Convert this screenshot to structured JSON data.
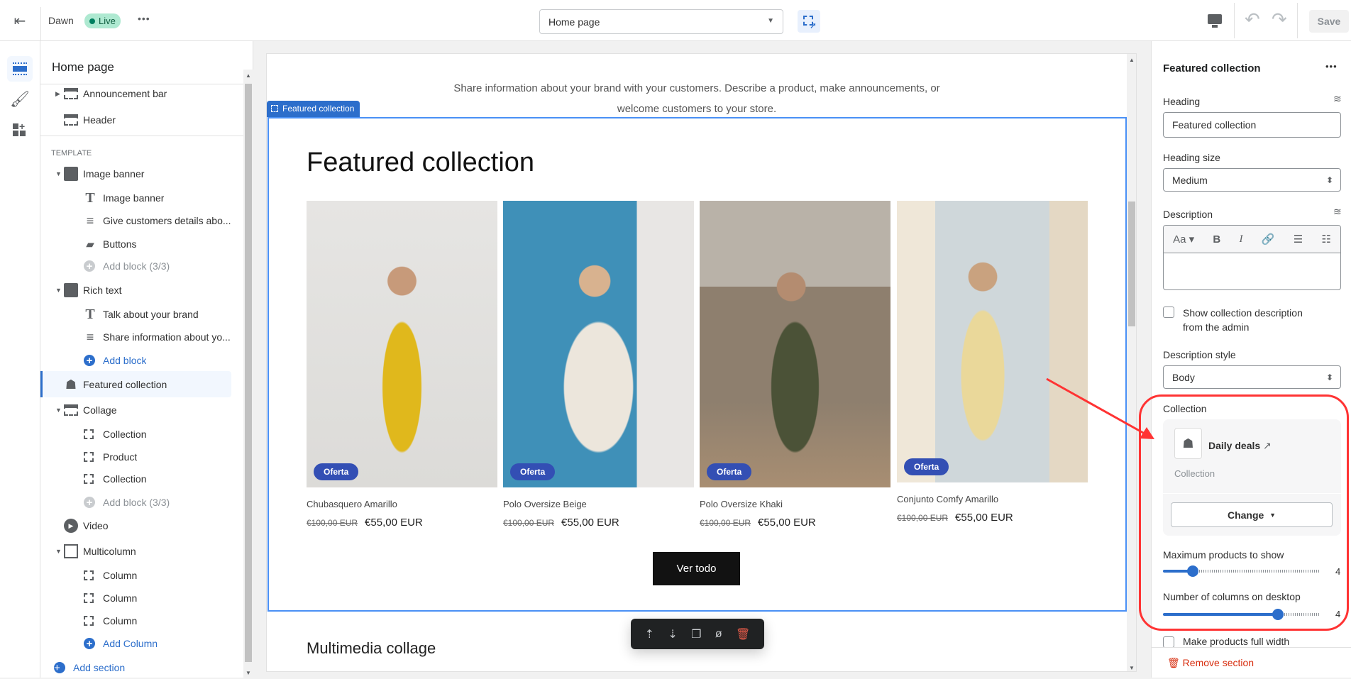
{
  "topbar": {
    "theme": "Dawn",
    "status": "Live",
    "more": "•••",
    "page_select": "Home page",
    "save": "Save"
  },
  "left": {
    "title": "Home page",
    "template_label": "TEMPLATE",
    "items": [
      {
        "label": "Announcement bar",
        "level": 0
      },
      {
        "label": "Header",
        "level": 0
      },
      {
        "label": "Image banner",
        "level": 0
      },
      {
        "label": "Image banner",
        "level": 1
      },
      {
        "label": "Give customers details abo...",
        "level": 1
      },
      {
        "label": "Buttons",
        "level": 1
      },
      {
        "label": "Add block (3/3)",
        "level": 1
      },
      {
        "label": "Rich text",
        "level": 0
      },
      {
        "label": "Talk about your brand",
        "level": 1
      },
      {
        "label": "Share information about yo...",
        "level": 1
      },
      {
        "label": "Add block",
        "level": 1
      },
      {
        "label": "Featured collection",
        "level": 0
      },
      {
        "label": "Collage",
        "level": 0
      },
      {
        "label": "Collection",
        "level": 1
      },
      {
        "label": "Product",
        "level": 1
      },
      {
        "label": "Collection",
        "level": 1
      },
      {
        "label": "Add block (3/3)",
        "level": 1
      },
      {
        "label": "Video",
        "level": 0
      },
      {
        "label": "Multicolumn",
        "level": 0
      },
      {
        "label": "Column",
        "level": 1
      },
      {
        "label": "Column",
        "level": 1
      },
      {
        "label": "Column",
        "level": 1
      },
      {
        "label": "Add Column",
        "level": 1
      },
      {
        "label": "Add section",
        "level": 0
      }
    ]
  },
  "preview": {
    "richtext_line1": "Share information about your brand with your customers. Describe a product, make announcements, or",
    "richtext_line2": "welcome customers to your store.",
    "section_tag": "Featured collection",
    "heading": "Featured collection",
    "products": [
      {
        "title": "Chubasquero Amarillo",
        "old": "€100,00 EUR",
        "price": "€55,00 EUR",
        "badge": "Oferta"
      },
      {
        "title": "Polo Oversize Beige",
        "old": "€100,00 EUR",
        "price": "€55,00 EUR",
        "badge": "Oferta"
      },
      {
        "title": "Polo Oversize Khaki",
        "old": "€100,00 EUR",
        "price": "€55,00 EUR",
        "badge": "Oferta"
      },
      {
        "title": "Conjunto Comfy Amarillo",
        "old": "€100,00 EUR",
        "price": "€55,00 EUR",
        "badge": "Oferta"
      }
    ],
    "view_all": "Ver todo",
    "next_section": "Multimedia collage"
  },
  "right": {
    "title": "Featured collection",
    "more": "•••",
    "heading_label": "Heading",
    "heading_value": "Featured collection",
    "heading_size_label": "Heading size",
    "heading_size_value": "Medium",
    "description_label": "Description",
    "show_desc_label": "Show collection description from the admin",
    "desc_style_label": "Description style",
    "desc_style_value": "Body",
    "collection_label": "Collection",
    "collection_name": "Daily deals",
    "collection_type": "Collection",
    "change": "Change",
    "max_products_label": "Maximum products to show",
    "max_products_value": "4",
    "max_products_fraction": 0.19,
    "columns_label": "Number of columns on desktop",
    "columns_value": "4",
    "columns_fraction": 0.73,
    "full_width_label": "Make products full width",
    "remove": "Remove section"
  },
  "colors": {
    "accent": "#2c6ecb",
    "annotation": "#ff3333",
    "live": "#aee9d1",
    "danger": "#d72c0d"
  }
}
